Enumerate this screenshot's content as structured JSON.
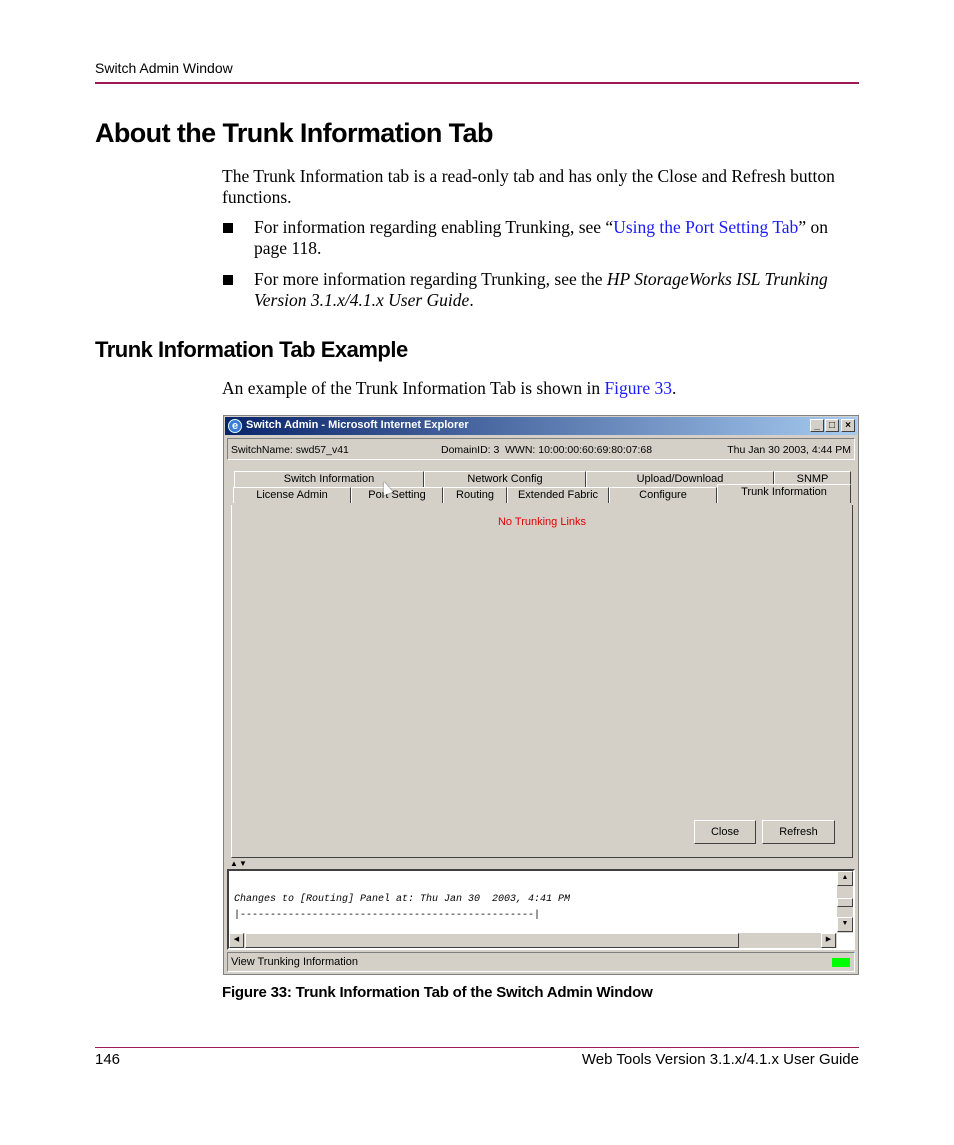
{
  "header": {
    "running_head": "Switch Admin Window"
  },
  "section": {
    "title": "About the Trunk Information Tab",
    "intro": "The Trunk Information tab is a read-only tab and has only the Close and Refresh button functions.",
    "bullets": [
      {
        "prefix": "For information regarding enabling Trunking, see “",
        "link": "Using the Port Setting Tab",
        "suffix": "” on page 118."
      },
      {
        "prefix": "For more information regarding Trunking, see the ",
        "italic": "HP StorageWorks ISL Trunking Version 3.1.x/4.1.x User Guide",
        "suffix": "."
      }
    ]
  },
  "subsection": {
    "title": "Trunk Information Tab Example",
    "text_prefix": "An example of the Trunk Information Tab is shown in ",
    "text_link": "Figure 33",
    "text_suffix": "."
  },
  "window": {
    "title": "Switch Admin - Microsoft Internet Explorer",
    "controls": {
      "minimize": "_",
      "maximize": "□",
      "close": "×"
    },
    "info": {
      "switch_name": "SwitchName: swd57_v41",
      "domain": "DomainID: 3",
      "wwn": "WWN: 10:00:00:60:69:80:07:68",
      "datetime": "Thu Jan 30  2003, 4:44 PM"
    },
    "tabs_row1": [
      "Switch Information",
      "Network Config",
      "Upload/Download",
      "SNMP"
    ],
    "tabs_row2": [
      "License Admin",
      "Port Setting",
      "Routing",
      "Extended Fabric",
      "Configure",
      "Trunk Information"
    ],
    "active_tab": "Trunk Information",
    "panel_message": "No Trunking Links",
    "panel_message_color": "#e00000",
    "buttons": {
      "close": "Close",
      "refresh": "Refresh"
    },
    "log_lines": [
      "Changes to [Routing] Panel at: Thu Jan 30  2003, 4:41 PM",
      "|-------------------------------------------------|"
    ],
    "status_text": "View Trunking Information",
    "status_led_color": "#00ff00"
  },
  "figure": {
    "caption": "Figure 33:  Trunk Information Tab of the Switch Admin Window"
  },
  "footer": {
    "page_number": "146",
    "book_title": "Web Tools Version 3.1.x/4.1.x User Guide"
  }
}
